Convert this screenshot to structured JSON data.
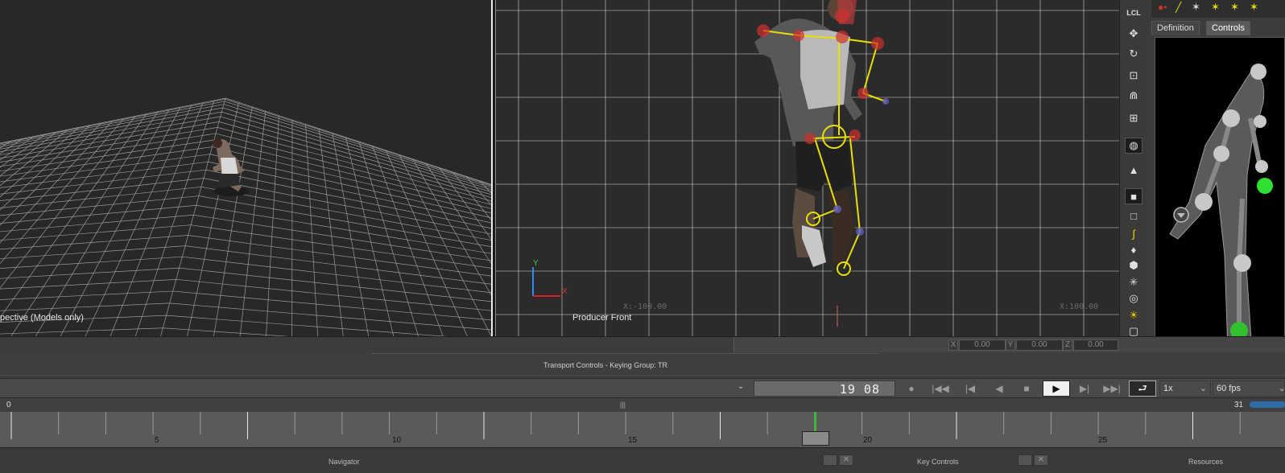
{
  "viewports": {
    "left_label": "pective (Models only)",
    "right_label": "Producer Front",
    "axis_y": "Y",
    "axis_x": "X",
    "ruler_left": "X:-100.00",
    "ruler_right": "X:100.00"
  },
  "toolbar": {
    "lcl_label": "LCL",
    "icons": [
      "move-icon",
      "rotate-icon",
      "scale-icon",
      "magnet-icon",
      "snap-icon",
      "globe-icon",
      "gravity-icon",
      "cube-solid-icon",
      "cube-outline-icon",
      "curve-icon",
      "pin-icon",
      "hexagon-icon",
      "star-icon",
      "eye-icon",
      "sun-icon",
      "frame-icon"
    ]
  },
  "character_panel": {
    "tab_definition": "Definition",
    "tab_controls": "Controls"
  },
  "status": {
    "x_tag": "X",
    "x_value": "0.00",
    "y_tag": "Y",
    "y_value": "0.00",
    "z_tag": "Z",
    "z_value": "0.00"
  },
  "transport": {
    "title": "Transport Controls  -  Keying Group: TR",
    "time_display": "19 08",
    "speed": "1x",
    "fps": "60 fps"
  },
  "timeline": {
    "start": "0",
    "end": "31",
    "current_frame": 18,
    "ticks": [
      "5",
      "10",
      "15",
      "20",
      "25"
    ]
  },
  "bottom_tabs": {
    "navigator": "Navigator",
    "key_controls": "Key Controls",
    "resources": "Resources"
  },
  "colors": {
    "accent_yellow": "#e8e000",
    "joint_red": "#d03030",
    "playhead_green": "#22cc22"
  }
}
